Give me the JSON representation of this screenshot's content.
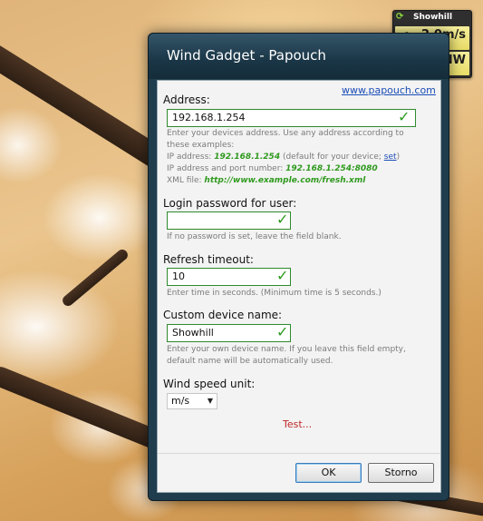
{
  "gadget": {
    "name": "Showhill",
    "speed": "2.0m/s",
    "direction": "NW",
    "icons": {
      "refresh": "refresh-icon",
      "fan": "fan-icon",
      "direction": "arrow-icon"
    }
  },
  "dialog": {
    "title": "Wind Gadget - Papouch",
    "link": "www.papouch.com",
    "address": {
      "label": "Address:",
      "value": "192.168.1.254",
      "hint1": "Enter your devices address. Use any address according to",
      "hint2": "these examples:",
      "ip_prefix": "IP address: ",
      "ip_example": "192.168.1.254",
      "ip_suffix": " (default for your device; ",
      "ip_set": "set",
      "ip_close": ")",
      "port_prefix": "IP address and port number: ",
      "port_example": "192.168.1.254:8080",
      "xml_prefix": "XML file: ",
      "xml_example": "http://www.example.com/fresh.xml"
    },
    "password": {
      "label": "Login password for user:",
      "value": "",
      "hint": "If no password is set, leave the field blank."
    },
    "refresh": {
      "label": "Refresh timeout:",
      "value": "10",
      "hint": "Enter time in seconds. (Minimum time is 5 seconds.)"
    },
    "device_name": {
      "label": "Custom device name:",
      "value": "Showhill",
      "hint1": "Enter your own device name. If you leave this field empty,",
      "hint2": "default name will be automatically used."
    },
    "unit": {
      "label": "Wind speed unit:",
      "selected": "m/s"
    },
    "test_link": "Test...",
    "ok_label": "OK",
    "cancel_label": "Storno",
    "check_glyph": "✓",
    "colors": {
      "field_border": "#2d8a2d",
      "check": "#2b9a1c",
      "example": "#2f9a1e",
      "test": "#c0282a",
      "link": "#1b4db5"
    }
  }
}
